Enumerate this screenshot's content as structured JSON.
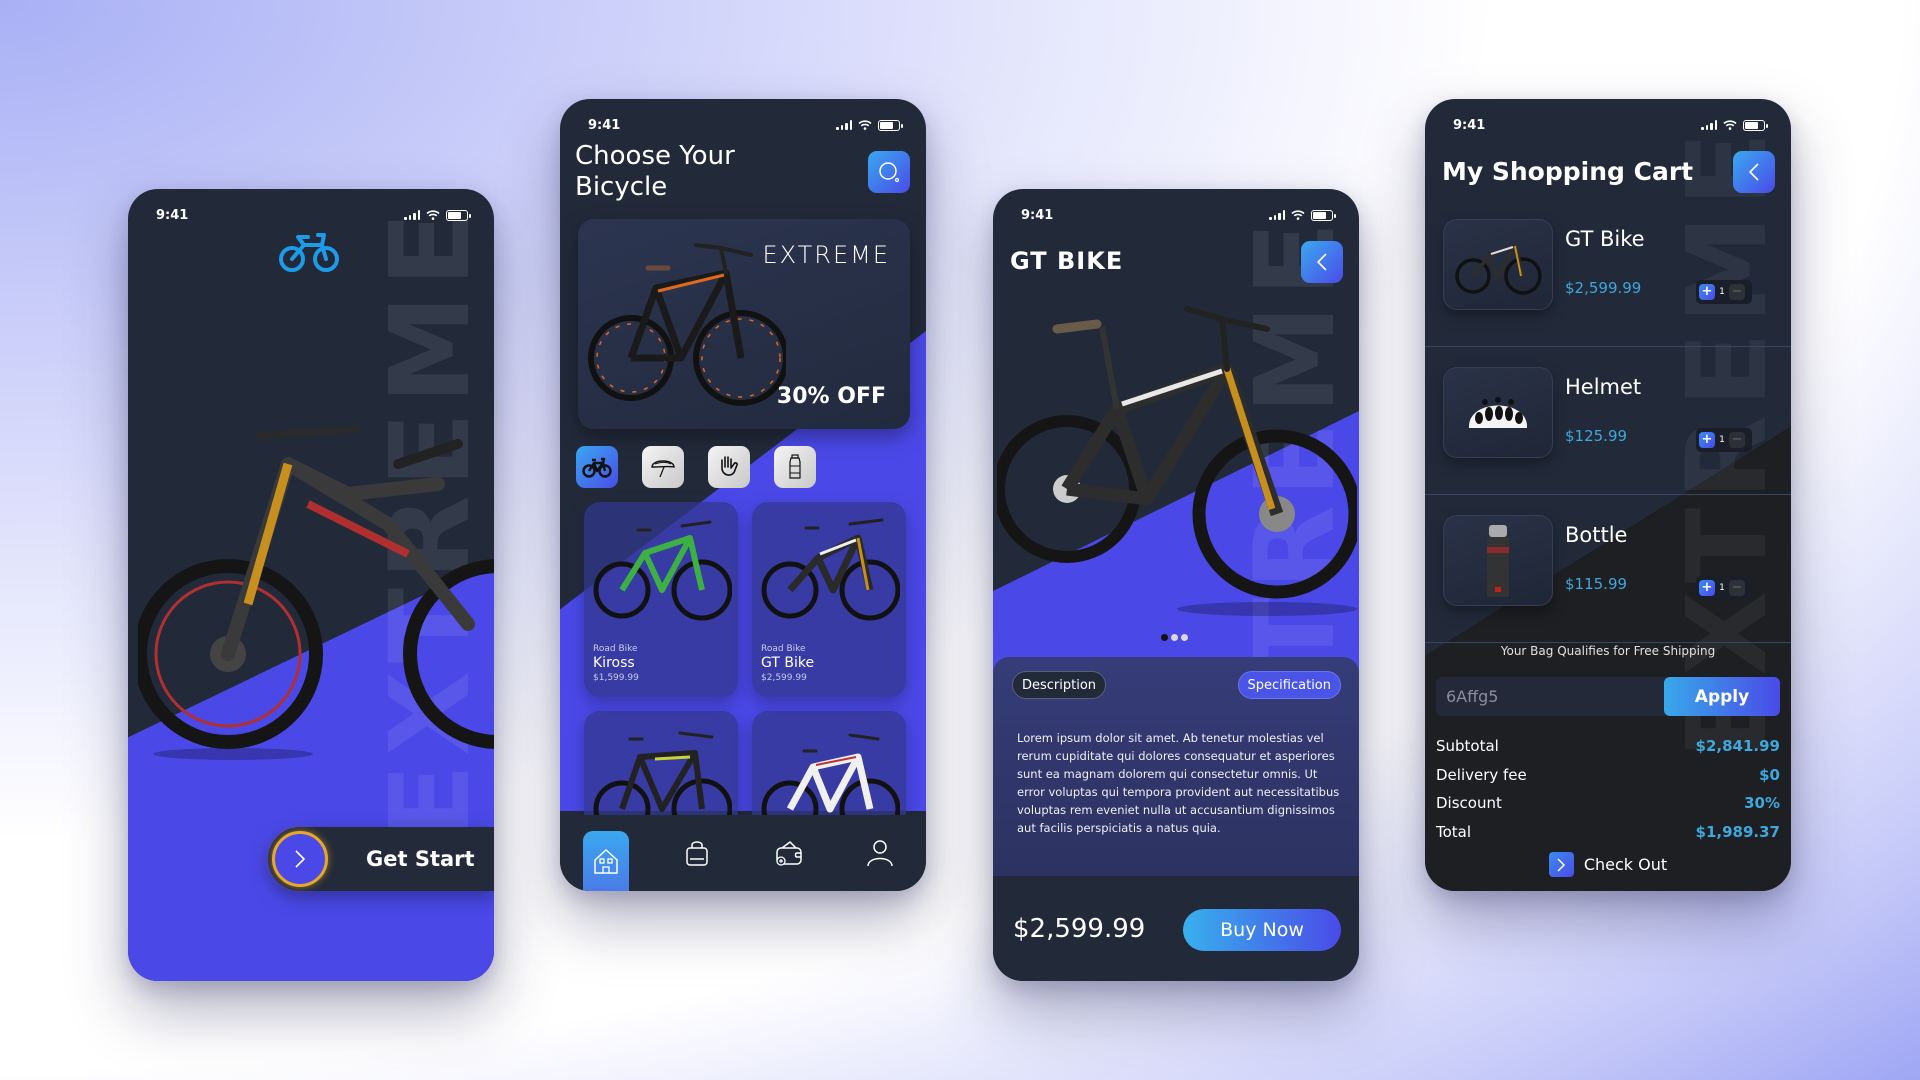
{
  "status_bar": {
    "time": "9:41"
  },
  "splash": {
    "watermark": "EXTREME",
    "cta_label": "Get Start",
    "colors": {
      "accent": "#4a49e8",
      "logo": "#1e9be8",
      "ring": "#e5a82a"
    }
  },
  "catalog": {
    "title_line1": "Choose Your",
    "title_line2": "Bicycle",
    "banner": {
      "brand": "EXTREME",
      "offer": "30% OFF"
    },
    "categories": [
      {
        "name": "bicycles",
        "icon": "bicycle-icon",
        "active": true
      },
      {
        "name": "helmets",
        "icon": "helmet-icon",
        "active": false
      },
      {
        "name": "gloves",
        "icon": "glove-icon",
        "active": false
      },
      {
        "name": "bottles",
        "icon": "bottle-icon",
        "active": false
      }
    ],
    "products": [
      {
        "type": "Road Bike",
        "name": "Kiross",
        "price": "$1,599.99",
        "frame_color": "#3cb043"
      },
      {
        "type": "Road Bike",
        "name": "GT Bike",
        "price": "$2,599.99",
        "frame_color": "#2a2a2a"
      },
      {
        "type": "",
        "name": "",
        "price": "",
        "frame_color": "#c8d43a"
      },
      {
        "type": "",
        "name": "",
        "price": "",
        "frame_color": "#f0f0f0"
      }
    ],
    "nav": [
      {
        "name": "home",
        "icon": "home-icon",
        "active": true
      },
      {
        "name": "bag",
        "icon": "bag-icon",
        "active": false
      },
      {
        "name": "wallet",
        "icon": "wallet-icon",
        "active": false
      },
      {
        "name": "profile",
        "icon": "user-icon",
        "active": false
      }
    ]
  },
  "detail": {
    "title": "GT BIKE",
    "watermark": "EXTREME",
    "carousel": {
      "total": 3,
      "active": 0
    },
    "tabs": {
      "description": "Description",
      "specification": "Specification"
    },
    "description": "Lorem ipsum dolor sit amet. Ab tenetur molestias vel rerum cupiditate qui dolores consequatur et asperiores sunt ea magnam dolorem qui consectetur omnis. Ut error voluptas qui tempora provident aut necessitatibus voluptas rem eveniet nulla ut accusantium dignissimos aut facilis perspiciatis a natus quia.",
    "price": "$2,599.99",
    "buy_label": "Buy Now"
  },
  "cart": {
    "title": "My Shopping Cart",
    "watermark": "EXTREME",
    "items": [
      {
        "name": "GT Bike",
        "price": "$2,599.99",
        "qty": "1"
      },
      {
        "name": "Helmet",
        "price": "$125.99",
        "qty": "1"
      },
      {
        "name": "Bottle",
        "price": "$115.99",
        "qty": "1"
      }
    ],
    "shipping_note": "Your Bag Qualifies for Free Shipping",
    "coupon_value": "6Affg5",
    "apply_label": "Apply",
    "summary": [
      {
        "label": "Subtotal",
        "value": "$2,841.99"
      },
      {
        "label": "Delivery fee",
        "value": "$0"
      },
      {
        "label": "Discount",
        "value": "30%"
      },
      {
        "label": "Total",
        "value": "$1,989.37"
      }
    ],
    "checkout_label": "Check Out",
    "price_color": "#3ea7db"
  }
}
